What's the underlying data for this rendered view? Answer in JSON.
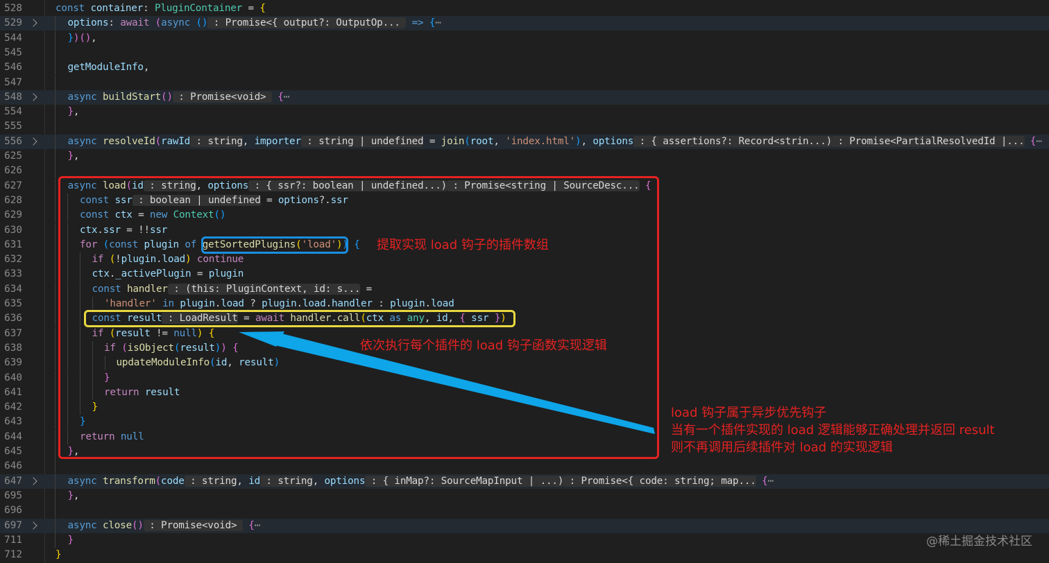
{
  "editor": {
    "lines": [
      {
        "n": "528",
        "fold": false,
        "folded": false,
        "indent": 0,
        "segs": [
          [
            "k",
            "const "
          ],
          [
            "v",
            "container"
          ],
          [
            "p",
            ": "
          ],
          [
            "t",
            "PluginContainer"
          ],
          [
            "p",
            " = "
          ],
          [
            "br1",
            "{"
          ]
        ]
      },
      {
        "n": "529",
        "fold": true,
        "folded": true,
        "indent": 1,
        "segs": [
          [
            "v",
            "options"
          ],
          [
            "p",
            ": "
          ],
          [
            "c",
            "await "
          ],
          [
            "br2",
            "("
          ],
          [
            "k",
            "async "
          ],
          [
            "br3",
            "()"
          ],
          [
            "hint",
            " : Promise<{ output?: OutputOp... "
          ],
          [
            "k",
            " => "
          ],
          [
            "br3",
            "{"
          ],
          [
            "ell",
            "⋯"
          ]
        ]
      },
      {
        "n": "544",
        "fold": false,
        "folded": false,
        "indent": 1,
        "segs": [
          [
            "br3",
            "}"
          ],
          [
            "br2",
            ")"
          ],
          [
            "br2",
            "()"
          ],
          [
            "p",
            ","
          ]
        ]
      },
      {
        "n": "545",
        "fold": false,
        "folded": false,
        "indent": 1,
        "segs": []
      },
      {
        "n": "546",
        "fold": false,
        "folded": false,
        "indent": 1,
        "segs": [
          [
            "v",
            "getModuleInfo"
          ],
          [
            "p",
            ","
          ]
        ]
      },
      {
        "n": "547",
        "fold": false,
        "folded": false,
        "indent": 1,
        "segs": []
      },
      {
        "n": "548",
        "fold": true,
        "folded": true,
        "indent": 1,
        "segs": [
          [
            "k",
            "async "
          ],
          [
            "f",
            "buildStart"
          ],
          [
            "br2",
            "()"
          ],
          [
            "hint",
            " : Promise<void> "
          ],
          [
            "p",
            " "
          ],
          [
            "br2",
            "{"
          ],
          [
            "ell",
            "⋯"
          ]
        ]
      },
      {
        "n": "554",
        "fold": false,
        "folded": false,
        "indent": 1,
        "segs": [
          [
            "br2",
            "}"
          ],
          [
            "p",
            ","
          ]
        ]
      },
      {
        "n": "555",
        "fold": false,
        "folded": false,
        "indent": 1,
        "segs": []
      },
      {
        "n": "556",
        "fold": true,
        "folded": true,
        "indent": 1,
        "segs": [
          [
            "k",
            "async "
          ],
          [
            "f",
            "resolveId"
          ],
          [
            "br2",
            "("
          ],
          [
            "v",
            "rawId"
          ],
          [
            "hint",
            " : string"
          ],
          [
            "p",
            ", "
          ],
          [
            "v",
            "importer"
          ],
          [
            "hint",
            " : string | undefined"
          ],
          [
            "p",
            " = "
          ],
          [
            "f",
            "join"
          ],
          [
            "br3",
            "("
          ],
          [
            "v",
            "root"
          ],
          [
            "p",
            ", "
          ],
          [
            "s",
            "'index.html'"
          ],
          [
            "br3",
            ")"
          ],
          [
            "p",
            ", "
          ],
          [
            "v",
            "options"
          ],
          [
            "hint",
            " : { assertions?: Record<strin...)"
          ],
          [
            "hint",
            " : Promise<PartialResolvedId |..."
          ],
          [
            "p",
            " "
          ],
          [
            "br2",
            "{"
          ],
          [
            "ell",
            "⋯"
          ]
        ]
      },
      {
        "n": "625",
        "fold": false,
        "folded": false,
        "indent": 1,
        "segs": [
          [
            "br2",
            "}"
          ],
          [
            "p",
            ","
          ]
        ]
      },
      {
        "n": "626",
        "fold": false,
        "folded": false,
        "indent": 1,
        "segs": []
      },
      {
        "n": "627",
        "fold": false,
        "folded": false,
        "indent": 1,
        "segs": [
          [
            "k",
            "async "
          ],
          [
            "f",
            "load"
          ],
          [
            "br2",
            "("
          ],
          [
            "v",
            "id"
          ],
          [
            "hint",
            " : string"
          ],
          [
            "p",
            ", "
          ],
          [
            "v",
            "options"
          ],
          [
            "hint",
            " : { ssr?: boolean | undefined...)"
          ],
          [
            "hint",
            " : Promise<string | SourceDesc..."
          ],
          [
            "p",
            " "
          ],
          [
            "br2",
            "{"
          ]
        ]
      },
      {
        "n": "628",
        "fold": false,
        "folded": false,
        "indent": 2,
        "segs": [
          [
            "k",
            "const "
          ],
          [
            "v",
            "ssr"
          ],
          [
            "hint",
            " : boolean | undefined"
          ],
          [
            "p",
            " = "
          ],
          [
            "v",
            "options"
          ],
          [
            "p",
            "?."
          ],
          [
            "v",
            "ssr"
          ]
        ]
      },
      {
        "n": "629",
        "fold": false,
        "folded": false,
        "indent": 2,
        "segs": [
          [
            "k",
            "const "
          ],
          [
            "v",
            "ctx"
          ],
          [
            "p",
            " = "
          ],
          [
            "k",
            "new "
          ],
          [
            "t",
            "Context"
          ],
          [
            "br3",
            "()"
          ]
        ]
      },
      {
        "n": "630",
        "fold": false,
        "folded": false,
        "indent": 2,
        "segs": [
          [
            "v",
            "ctx"
          ],
          [
            "p",
            "."
          ],
          [
            "v",
            "ssr"
          ],
          [
            "p",
            " = !!"
          ],
          [
            "v",
            "ssr"
          ]
        ]
      },
      {
        "n": "631",
        "fold": false,
        "folded": false,
        "indent": 2,
        "segs": [
          [
            "c",
            "for "
          ],
          [
            "br3",
            "("
          ],
          [
            "k",
            "const "
          ],
          [
            "v",
            "plugin "
          ],
          [
            "k",
            "of "
          ],
          [
            "f",
            "getSortedPlugins"
          ],
          [
            "br1",
            "("
          ],
          [
            "s",
            "'load'"
          ],
          [
            "br1",
            ")"
          ],
          [
            "br3",
            ")"
          ],
          [
            "p",
            " "
          ],
          [
            "br3",
            "{"
          ]
        ]
      },
      {
        "n": "632",
        "fold": false,
        "folded": false,
        "indent": 3,
        "segs": [
          [
            "c",
            "if "
          ],
          [
            "br1",
            "("
          ],
          [
            "p",
            "!"
          ],
          [
            "v",
            "plugin"
          ],
          [
            "p",
            "."
          ],
          [
            "v",
            "load"
          ],
          [
            "br1",
            ")"
          ],
          [
            "c",
            " continue"
          ]
        ]
      },
      {
        "n": "633",
        "fold": false,
        "folded": false,
        "indent": 3,
        "segs": [
          [
            "v",
            "ctx"
          ],
          [
            "p",
            "."
          ],
          [
            "v",
            "_activePlugin"
          ],
          [
            "p",
            " = "
          ],
          [
            "v",
            "plugin"
          ]
        ]
      },
      {
        "n": "634",
        "fold": false,
        "folded": false,
        "indent": 3,
        "segs": [
          [
            "k",
            "const "
          ],
          [
            "f",
            "handler"
          ],
          [
            "hint",
            " : (this: PluginContext, id: s..."
          ],
          [
            "p",
            " ="
          ]
        ]
      },
      {
        "n": "635",
        "fold": false,
        "folded": false,
        "indent": 4,
        "segs": [
          [
            "s",
            "'handler'"
          ],
          [
            "k",
            " in "
          ],
          [
            "v",
            "plugin"
          ],
          [
            "p",
            "."
          ],
          [
            "v",
            "load"
          ],
          [
            "p",
            " ? "
          ],
          [
            "v",
            "plugin"
          ],
          [
            "p",
            "."
          ],
          [
            "v",
            "load"
          ],
          [
            "p",
            "."
          ],
          [
            "v",
            "handler"
          ],
          [
            "p",
            " : "
          ],
          [
            "v",
            "plugin"
          ],
          [
            "p",
            "."
          ],
          [
            "v",
            "load"
          ]
        ]
      },
      {
        "n": "636",
        "fold": false,
        "folded": false,
        "indent": 3,
        "segs": [
          [
            "k",
            "const "
          ],
          [
            "v",
            "result"
          ],
          [
            "hint",
            " : LoadResult"
          ],
          [
            "p",
            " = "
          ],
          [
            "c",
            "await "
          ],
          [
            "f",
            "handler"
          ],
          [
            "p",
            "."
          ],
          [
            "f",
            "call"
          ],
          [
            "br1",
            "("
          ],
          [
            "v",
            "ctx "
          ],
          [
            "k",
            "as "
          ],
          [
            "t",
            "any"
          ],
          [
            "p",
            ", "
          ],
          [
            "v",
            "id"
          ],
          [
            "p",
            ", "
          ],
          [
            "br2",
            "{ "
          ],
          [
            "v",
            "ssr "
          ],
          [
            "br2",
            "}"
          ],
          [
            "br1",
            ")"
          ]
        ]
      },
      {
        "n": "637",
        "fold": false,
        "folded": false,
        "indent": 3,
        "segs": [
          [
            "c",
            "if "
          ],
          [
            "br1",
            "("
          ],
          [
            "v",
            "result "
          ],
          [
            "p",
            "!= "
          ],
          [
            "k",
            "null"
          ],
          [
            "br1",
            ")"
          ],
          [
            "p",
            " "
          ],
          [
            "br1",
            "{"
          ]
        ]
      },
      {
        "n": "638",
        "fold": false,
        "folded": false,
        "indent": 4,
        "segs": [
          [
            "c",
            "if "
          ],
          [
            "br2",
            "("
          ],
          [
            "f",
            "isObject"
          ],
          [
            "br3",
            "("
          ],
          [
            "v",
            "result"
          ],
          [
            "br3",
            ")"
          ],
          [
            "br2",
            ")"
          ],
          [
            "p",
            " "
          ],
          [
            "br2",
            "{"
          ]
        ]
      },
      {
        "n": "639",
        "fold": false,
        "folded": false,
        "indent": 5,
        "segs": [
          [
            "f",
            "updateModuleInfo"
          ],
          [
            "br3",
            "("
          ],
          [
            "v",
            "id"
          ],
          [
            "p",
            ", "
          ],
          [
            "v",
            "result"
          ],
          [
            "br3",
            ")"
          ]
        ]
      },
      {
        "n": "640",
        "fold": false,
        "folded": false,
        "indent": 4,
        "segs": [
          [
            "br2",
            "}"
          ]
        ]
      },
      {
        "n": "641",
        "fold": false,
        "folded": false,
        "indent": 4,
        "segs": [
          [
            "c",
            "return "
          ],
          [
            "v",
            "result"
          ]
        ]
      },
      {
        "n": "642",
        "fold": false,
        "folded": false,
        "indent": 3,
        "segs": [
          [
            "br1",
            "}"
          ]
        ]
      },
      {
        "n": "643",
        "fold": false,
        "folded": false,
        "indent": 2,
        "segs": [
          [
            "br3",
            "}"
          ]
        ]
      },
      {
        "n": "644",
        "fold": false,
        "folded": false,
        "indent": 2,
        "segs": [
          [
            "c",
            "return "
          ],
          [
            "k",
            "null"
          ]
        ]
      },
      {
        "n": "645",
        "fold": false,
        "folded": false,
        "indent": 1,
        "segs": [
          [
            "br2",
            "}"
          ],
          [
            "p",
            ","
          ]
        ]
      },
      {
        "n": "646",
        "fold": false,
        "folded": false,
        "indent": 1,
        "segs": []
      },
      {
        "n": "647",
        "fold": true,
        "folded": true,
        "indent": 1,
        "segs": [
          [
            "k",
            "async "
          ],
          [
            "f",
            "transform"
          ],
          [
            "br2",
            "("
          ],
          [
            "v",
            "code"
          ],
          [
            "hint",
            " : string"
          ],
          [
            "p",
            ", "
          ],
          [
            "v",
            "id"
          ],
          [
            "hint",
            " : string"
          ],
          [
            "p",
            ", "
          ],
          [
            "v",
            "options"
          ],
          [
            "hint",
            " : { inMap?: SourceMapInput | ...)"
          ],
          [
            "hint",
            " : Promise<{ code: string; map..."
          ],
          [
            "p",
            " "
          ],
          [
            "br2",
            "{"
          ],
          [
            "ell",
            "⋯"
          ]
        ]
      },
      {
        "n": "695",
        "fold": false,
        "folded": false,
        "indent": 1,
        "segs": [
          [
            "br2",
            "}"
          ],
          [
            "p",
            ","
          ]
        ]
      },
      {
        "n": "696",
        "fold": false,
        "folded": false,
        "indent": 1,
        "segs": []
      },
      {
        "n": "697",
        "fold": true,
        "folded": true,
        "indent": 1,
        "segs": [
          [
            "k",
            "async "
          ],
          [
            "f",
            "close"
          ],
          [
            "br2",
            "()"
          ],
          [
            "hint",
            " : Promise<void> "
          ],
          [
            "p",
            " "
          ],
          [
            "br2",
            "{"
          ],
          [
            "ell",
            "⋯"
          ]
        ]
      },
      {
        "n": "711",
        "fold": false,
        "folded": false,
        "indent": 1,
        "segs": [
          [
            "br2",
            "}"
          ]
        ]
      },
      {
        "n": "712",
        "fold": false,
        "folded": false,
        "indent": 0,
        "segs": [
          [
            "br1",
            "}"
          ]
        ]
      }
    ]
  },
  "annotations": {
    "blue_note": "提取实现 load 钩子的插件数组",
    "arrow_note": "依次执行每个插件的 load 钩子函数实现逻辑",
    "bottom_note_1": "load 钩子属于异步优先钩子",
    "bottom_note_2": "当有一个插件实现的 load 逻辑能够正确处理并返回 result",
    "bottom_note_3": "则不再调用后续插件对 load 的实现逻辑"
  },
  "watermark": "@稀土掘金技术社区",
  "colors": {
    "background": "#1f1f1f",
    "red_box": "#e52222",
    "blue_box": "#1a8fe0",
    "yellow_box": "#e8d840",
    "arrow": "#0ea5e9"
  }
}
